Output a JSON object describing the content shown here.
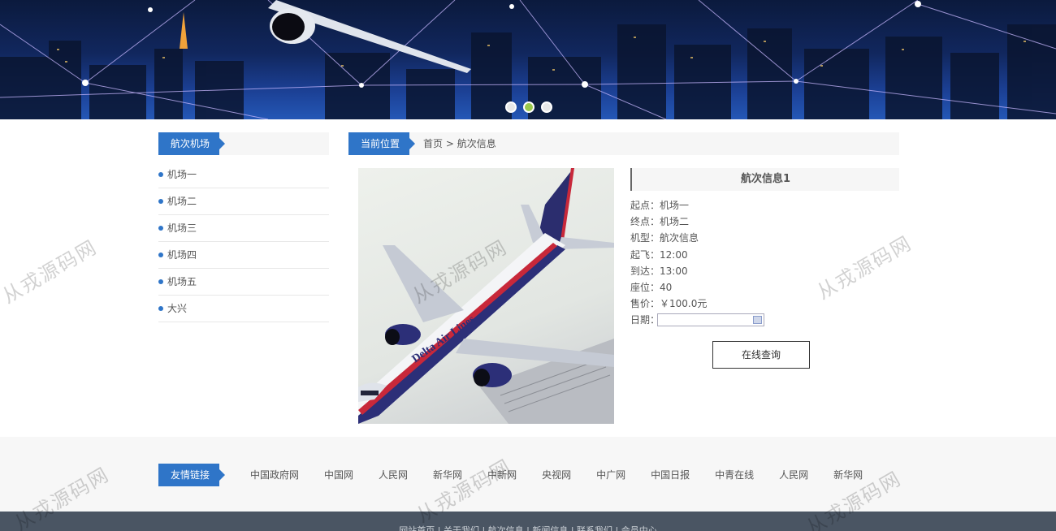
{
  "banner": {
    "slides": 3,
    "active_slide": 2
  },
  "sidebar": {
    "title": "航次机场",
    "items": [
      "机场一",
      "机场二",
      "机场三",
      "机场四",
      "机场五",
      "大兴"
    ]
  },
  "breadcrumb": {
    "title": "当前位置",
    "home": "首页",
    "separator": ">",
    "current": "航次信息"
  },
  "detail": {
    "title": "航次信息1",
    "origin": "起点：机场一",
    "destination": "终点：机场二",
    "model": "机型：航次信息",
    "depart": "起飞：12:00",
    "arrive": "到达：13:00",
    "seats": "座位：40",
    "price": "售价：￥100.0元",
    "date_label": "日期：",
    "date_value": "",
    "query_button": "在线查询"
  },
  "links": {
    "title": "友情链接",
    "items": [
      "中国政府网",
      "中国网",
      "人民网",
      "新华网",
      "中新网",
      "央视网",
      "中广网",
      "中国日报",
      "中青在线",
      "人民网",
      "新华网"
    ]
  },
  "footer": {
    "text": "网站首页 | 关于我们 | 航次信息 | 新闻信息 | 联系我们 | 会员中心"
  },
  "watermark": "从戎源码网",
  "colors": {
    "accent": "#2f75c8",
    "footer": "#4a5563",
    "dot_active": "#9ac94c"
  }
}
